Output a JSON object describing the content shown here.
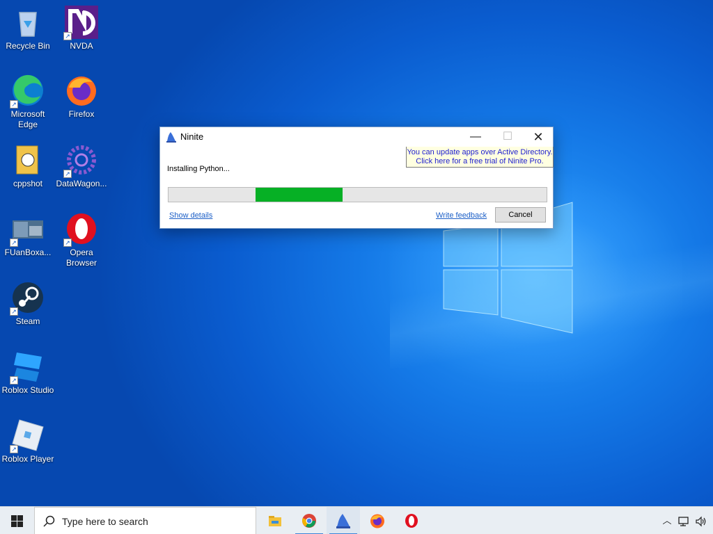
{
  "desktop": {
    "icons": [
      {
        "label": "Recycle Bin"
      },
      {
        "label": "NVDA"
      },
      {
        "label": "Microsoft Edge"
      },
      {
        "label": "Firefox"
      },
      {
        "label": "cppshot"
      },
      {
        "label": "DataWagon..."
      },
      {
        "label": "FUanBoxa..."
      },
      {
        "label": "Opera Browser"
      },
      {
        "label": "Steam"
      },
      {
        "label": "Roblox Studio"
      },
      {
        "label": "Roblox Player"
      }
    ]
  },
  "window": {
    "title": "Ninite",
    "promo_line1": "You can update apps over Active Directory.",
    "promo_line2": "Click here for a free trial of Ninite Pro.",
    "status": "Installing Python...",
    "progress_fraction": 0.23,
    "show_details": "Show details",
    "write_feedback": "Write feedback",
    "cancel": "Cancel"
  },
  "taskbar": {
    "search_placeholder": "Type here to search",
    "apps": [
      "file-explorer",
      "chrome",
      "ninite",
      "firefox",
      "opera"
    ],
    "active_app": "ninite"
  },
  "colors": {
    "progress": "#06b025",
    "link": "#1c5fc7",
    "promo_text": "#1c1ccf",
    "promo_bg": "#ffffe1"
  }
}
